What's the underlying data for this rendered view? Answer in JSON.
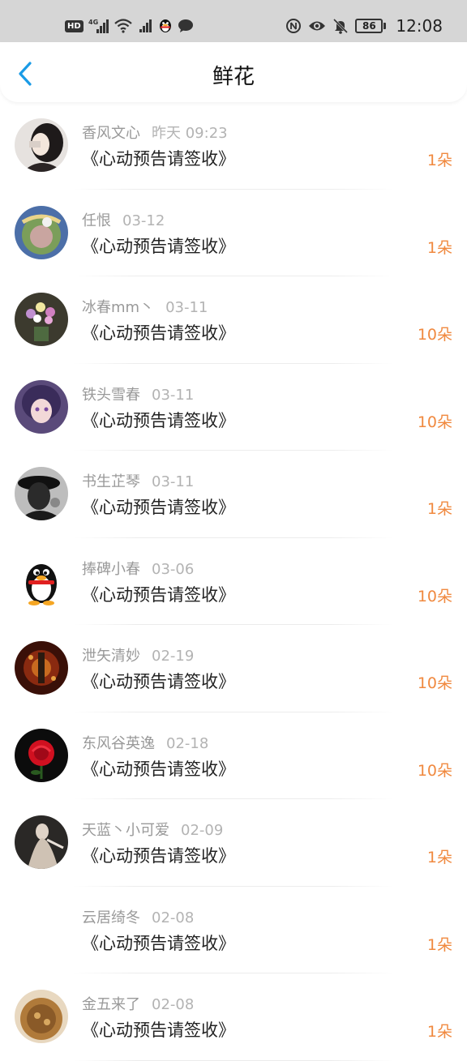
{
  "status_bar": {
    "hd": "HD",
    "signal_label": "4G",
    "battery": "86",
    "time": "12:08",
    "icons": [
      "hd-icon",
      "signal-icon",
      "wifi-icon",
      "signal-2-icon",
      "qq-icon",
      "message-icon",
      "nfc-icon",
      "eye-icon",
      "bell-off-icon",
      "battery-icon"
    ]
  },
  "header": {
    "title": "鲜花",
    "back_icon": "chevron-left-icon"
  },
  "colors": {
    "accent": "#1a9be6",
    "count": "#f0893f",
    "name": "#999999",
    "date": "#b3b3b3"
  },
  "items": [
    {
      "name": "香风文心",
      "date": "昨天 09:23",
      "gift": "《心动预告请签收》",
      "count": "1朵"
    },
    {
      "name": "任恨",
      "date": "03-12",
      "gift": "《心动预告请签收》",
      "count": "1朵"
    },
    {
      "name": "冰春mm丶",
      "date": "03-11",
      "gift": "《心动预告请签收》",
      "count": "10朵"
    },
    {
      "name": "铁头雪春",
      "date": "03-11",
      "gift": "《心动预告请签收》",
      "count": "10朵"
    },
    {
      "name": "书生芷琴",
      "date": "03-11",
      "gift": "《心动预告请签收》",
      "count": "1朵"
    },
    {
      "name": "捧碑小春",
      "date": "03-06",
      "gift": "《心动预告请签收》",
      "count": "10朵"
    },
    {
      "name": "泄矢清妙",
      "date": "02-19",
      "gift": "《心动预告请签收》",
      "count": "10朵"
    },
    {
      "name": "东风谷英逸",
      "date": "02-18",
      "gift": "《心动预告请签收》",
      "count": "10朵"
    },
    {
      "name": "天蓝丶小可爱",
      "date": "02-09",
      "gift": "《心动预告请签收》",
      "count": "1朵"
    },
    {
      "name": "云居绮冬",
      "date": "02-08",
      "gift": "《心动预告请签收》",
      "count": "1朵"
    },
    {
      "name": "金五来了",
      "date": "02-08",
      "gift": "《心动预告请签收》",
      "count": "1朵"
    }
  ]
}
